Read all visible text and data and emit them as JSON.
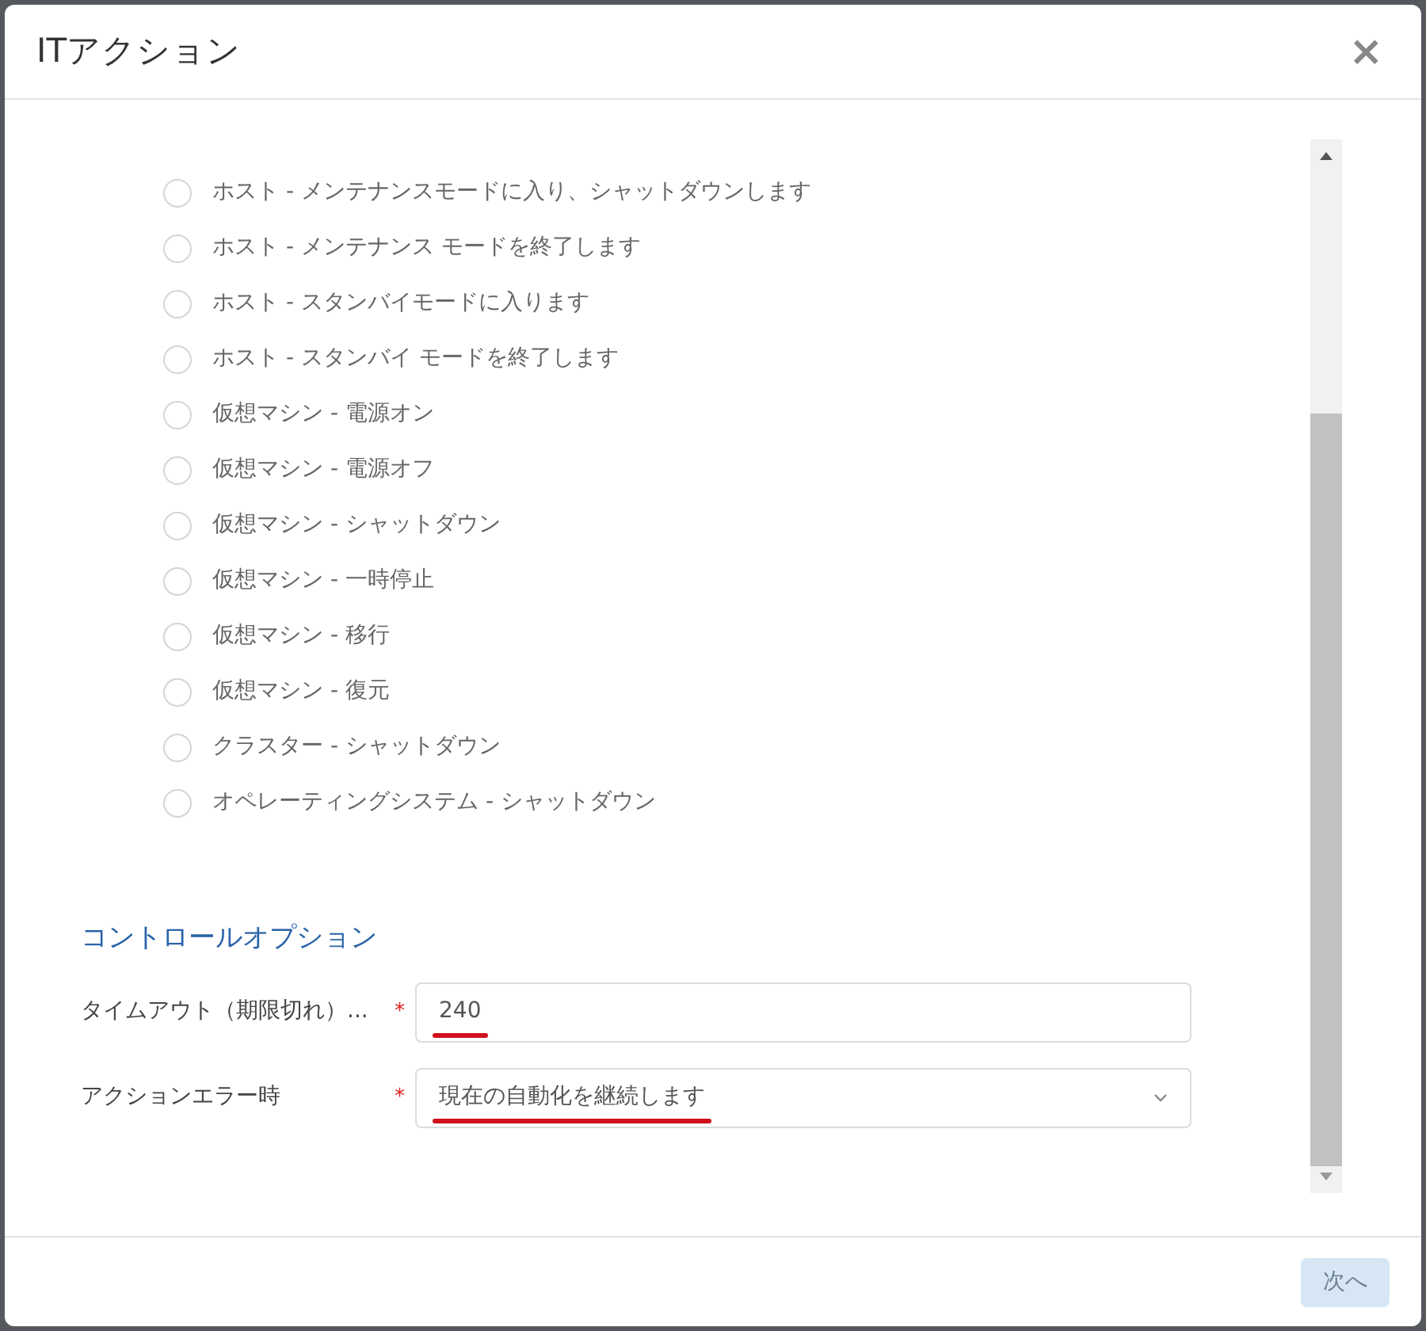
{
  "dialog": {
    "title": "ITアクション",
    "close": "×"
  },
  "actions": [
    {
      "label": "ホスト - メンテナンスモードに入り、シャットダウンします",
      "selected": false
    },
    {
      "label": "ホスト - メンテナンス モードを終了します",
      "selected": false
    },
    {
      "label": "ホスト - スタンバイモードに入ります",
      "selected": false
    },
    {
      "label": "ホスト - スタンバイ モードを終了します",
      "selected": false
    },
    {
      "label": "仮想マシン - 電源オン",
      "selected": false
    },
    {
      "label": "仮想マシン - 電源オフ",
      "selected": false
    },
    {
      "label": "仮想マシン - シャットダウン",
      "selected": false
    },
    {
      "label": "仮想マシン - 一時停止",
      "selected": false
    },
    {
      "label": "仮想マシン - 移行",
      "selected": false
    },
    {
      "label": "仮想マシン - 復元",
      "selected": false
    },
    {
      "label": "クラスター - シャットダウン",
      "selected": false
    },
    {
      "label": "オペレーティングシステム - シャットダウン",
      "selected": false
    }
  ],
  "control_options": {
    "heading": "コントロールオプション",
    "fields": [
      {
        "kind": "text",
        "label": "タイムアウト（期限切れ）...",
        "required": "*",
        "value": "240",
        "underlined": true
      },
      {
        "kind": "select",
        "label": "アクションエラー時",
        "required": "*",
        "value": "現在の自動化を継続します",
        "underlined": true
      }
    ]
  },
  "footer": {
    "next_button": "次へ"
  }
}
